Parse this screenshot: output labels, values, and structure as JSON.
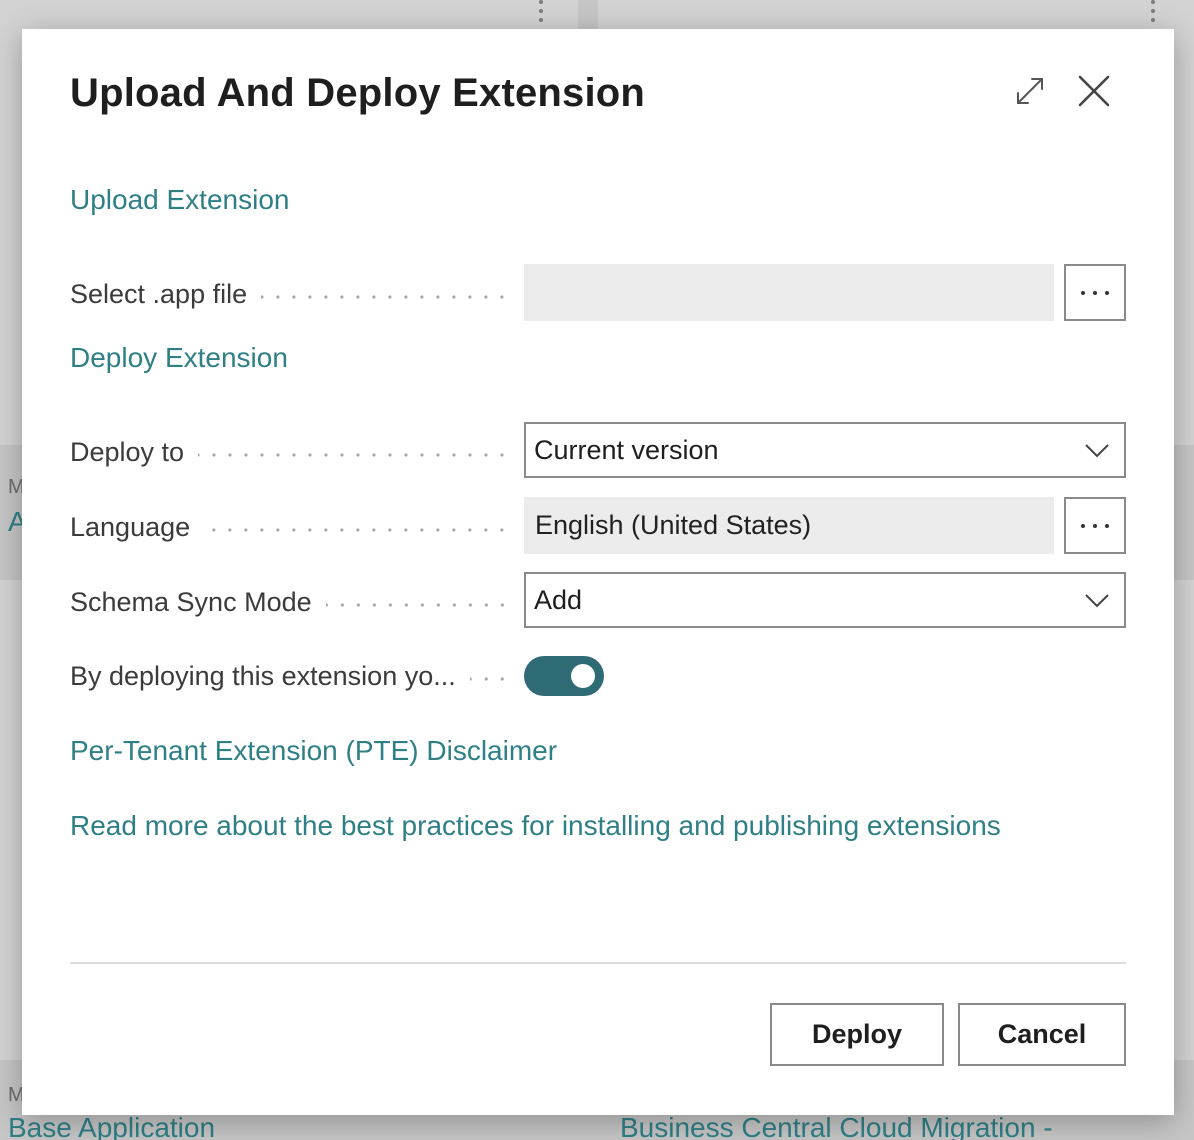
{
  "background": {
    "left_top_link_partial": "A",
    "left_top_small_partial": "M",
    "left_bottom_small_partial": "M",
    "bottom_left_link": "Base Application",
    "bottom_right_link": "Business Central Cloud Migration -"
  },
  "dialog": {
    "title": "Upload And Deploy Extension",
    "expand_icon": "expand-arrows-icon",
    "close_icon": "close-icon",
    "upload_section_label": "Upload Extension",
    "deploy_section_label": "Deploy Extension",
    "fields": {
      "select_app_file": {
        "label": "Select .app file",
        "value": "",
        "lookup_icon": "ellipsis-icon"
      },
      "deploy_to": {
        "label": "Deploy to",
        "value": "Current version"
      },
      "language": {
        "label": "Language",
        "value": "English (United States)",
        "lookup_icon": "ellipsis-icon"
      },
      "schema_sync_mode": {
        "label": "Schema Sync Mode",
        "value": "Add"
      },
      "accept_disclaimer": {
        "label": "By deploying this extension yo...",
        "value": true
      }
    },
    "disclaimer_link": "Per-Tenant Extension (PTE) Disclaimer",
    "best_practices_link": "Read more about the best practices for installing and publishing extensions",
    "buttons": {
      "deploy": "Deploy",
      "cancel": "Cancel"
    }
  },
  "colors": {
    "accent_link": "#2f7f86",
    "toggle_on": "#2e6b75",
    "readonly_fill": "#ececec",
    "overlay": "#c6c6c6"
  }
}
